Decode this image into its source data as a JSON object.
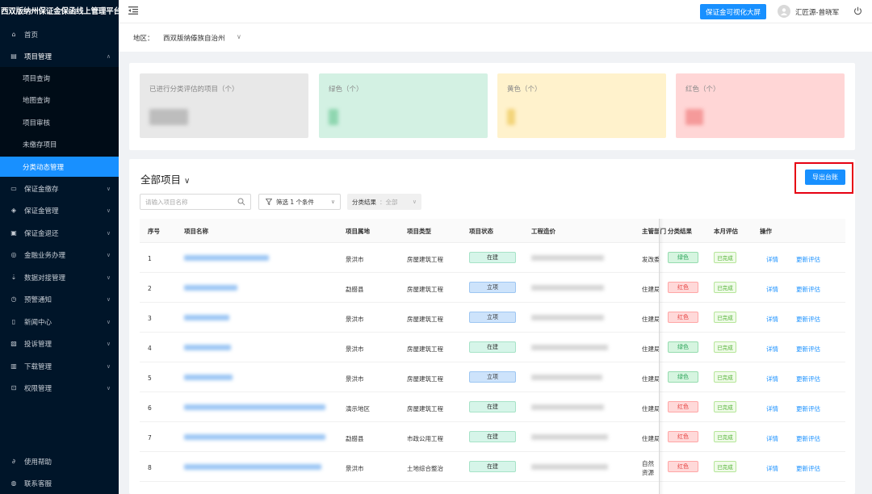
{
  "app": {
    "title": "西双版纳州保证金保函线上管理平台"
  },
  "header": {
    "screen_button": "保证金可视化大屏",
    "username": "汇匠源-曾晓军"
  },
  "sidebar": {
    "items": [
      {
        "label": "首页",
        "icon": "home-icon"
      },
      {
        "label": "项目管理",
        "icon": "project-icon"
      },
      {
        "label": "保证金缴存",
        "icon": "deposit-icon"
      },
      {
        "label": "保证金管理",
        "icon": "guarantee-icon"
      },
      {
        "label": "保证金退还",
        "icon": "refund-icon"
      },
      {
        "label": "金融业务办理",
        "icon": "finance-icon"
      },
      {
        "label": "数据对接管理",
        "icon": "data-icon"
      },
      {
        "label": "预警通知",
        "icon": "warning-icon"
      },
      {
        "label": "新闻中心",
        "icon": "news-icon"
      },
      {
        "label": "投诉管理",
        "icon": "complaint-icon"
      },
      {
        "label": "下载管理",
        "icon": "download-icon"
      },
      {
        "label": "权限管理",
        "icon": "lock-icon"
      }
    ],
    "sub_items": [
      "项目查询",
      "地图查询",
      "项目审核",
      "未缴存项目",
      "分类动态管理"
    ],
    "bottom": [
      {
        "label": "使用帮助",
        "icon": "help-icon"
      },
      {
        "label": "联系客服",
        "icon": "service-icon"
      }
    ]
  },
  "region": {
    "label": "地区：",
    "value": "西双版纳傣族自治州"
  },
  "stats": {
    "total_label": "已进行分类评估的项目（个）",
    "green_label": "绿色（个）",
    "yellow_label": "黄色（个）",
    "red_label": "红色（个）"
  },
  "panel": {
    "title": "全部项目",
    "export_button": "导出台账",
    "search_placeholder": "请输入项目名称",
    "filter_label": "筛选 1 个条件",
    "class_label": "分类结果",
    "class_value": "：全部"
  },
  "table": {
    "headers": [
      "序号",
      "项目名称",
      "项目属地",
      "项目类型",
      "项目状态",
      "工程造价",
      "主管部门",
      "分类结果",
      "本月评估",
      "操作"
    ],
    "rows": [
      {
        "no": "1",
        "location": "景洪市",
        "type": "房屋建筑工程",
        "status": "在建",
        "dept": "发改委",
        "result": "绿色",
        "monthly": "已完成"
      },
      {
        "no": "2",
        "location": "勐腊县",
        "type": "房屋建筑工程",
        "status": "立项",
        "dept": "住建局",
        "result": "红色",
        "monthly": "已完成"
      },
      {
        "no": "3",
        "location": "景洪市",
        "type": "房屋建筑工程",
        "status": "立项",
        "dept": "住建局",
        "result": "红色",
        "monthly": "已完成"
      },
      {
        "no": "4",
        "location": "景洪市",
        "type": "房屋建筑工程",
        "status": "在建",
        "dept": "住建局",
        "result": "绿色",
        "monthly": "已完成"
      },
      {
        "no": "5",
        "location": "景洪市",
        "type": "房屋建筑工程",
        "status": "立项",
        "dept": "住建局",
        "result": "绿色",
        "monthly": "已完成"
      },
      {
        "no": "6",
        "location": "演示地区",
        "type": "房屋建筑工程",
        "status": "在建",
        "dept": "住建局",
        "result": "红色",
        "monthly": "已完成"
      },
      {
        "no": "7",
        "location": "勐腊县",
        "type": "市政公用工程",
        "status": "在建",
        "dept": "住建局",
        "result": "红色",
        "monthly": "已完成"
      },
      {
        "no": "8",
        "location": "景洪市",
        "type": "土地综合整治",
        "status": "在建",
        "dept": "自然资源局",
        "result": "红色",
        "monthly": "已完成"
      }
    ],
    "op_detail": "详情",
    "op_update": "更新评估"
  },
  "colors": {
    "primary": "#1890ff",
    "sidebar": "#001529",
    "highlight": "#e60012"
  }
}
